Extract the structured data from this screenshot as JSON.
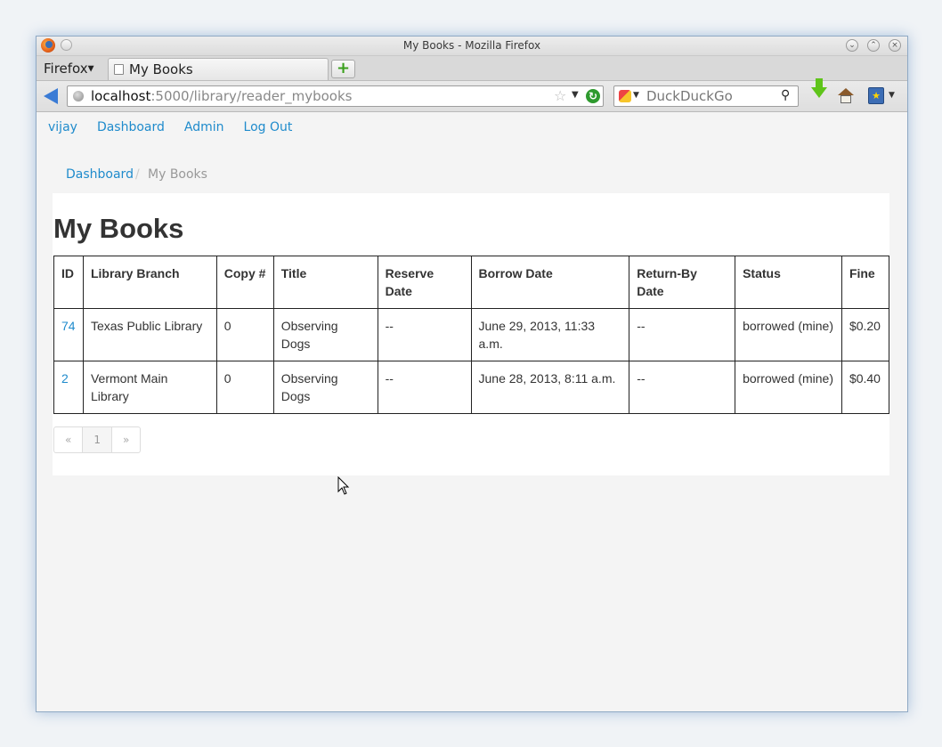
{
  "window": {
    "title": "My Books - Mozilla Firefox",
    "menu_label": "Firefox",
    "tab_label": "My Books"
  },
  "navbar": {
    "url_host": "localhost",
    "url_path": ":5000/library/reader_mybooks",
    "search_placeholder": "DuckDuckGo"
  },
  "topnav": {
    "items": [
      "vijay",
      "Dashboard",
      "Admin",
      "Log Out"
    ]
  },
  "breadcrumb": {
    "link": "Dashboard",
    "separator": "/",
    "current": "My Books"
  },
  "page": {
    "heading": "My Books"
  },
  "table": {
    "headers": [
      "ID",
      "Library Branch",
      "Copy #",
      "Title",
      "Reserve Date",
      "Borrow Date",
      "Return-By Date",
      "Status",
      "Fine"
    ],
    "rows": [
      [
        "74",
        "Texas Public Library",
        "0",
        "Observing Dogs",
        "--",
        "June 29, 2013, 11:33 a.m.",
        "--",
        "borrowed (mine)",
        "$0.20"
      ],
      [
        "2",
        "Vermont Main Library",
        "0",
        "Observing Dogs",
        "--",
        "June 28, 2013, 8:11 a.m.",
        "--",
        "borrowed (mine)",
        "$0.40"
      ]
    ]
  },
  "pagination": {
    "prev": "«",
    "current": "1",
    "next": "»"
  }
}
